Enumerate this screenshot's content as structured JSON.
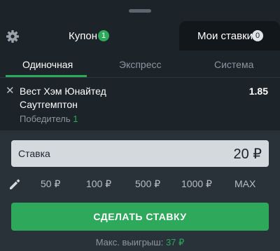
{
  "tabs": {
    "coupon_label": "Купон",
    "coupon_count": "1",
    "my_bets_label": "Мои ставки",
    "my_bets_count": "0"
  },
  "bet_types": [
    "Одиночная",
    "Экспресс",
    "Система"
  ],
  "active_bet_type": "Одиночная",
  "bet": {
    "team_home": "Вест Хэм Юнайтед",
    "team_away": "Саутгемптон",
    "outcome_label": "Победитель",
    "outcome_value": "1",
    "odd": "1.85"
  },
  "stake": {
    "label": "Ставка",
    "value": "20 ₽"
  },
  "quick_amounts": [
    "50 ₽",
    "100 ₽",
    "500 ₽",
    "1000 ₽",
    "MAX"
  ],
  "cta": "СДЕЛАТЬ СТАВКУ",
  "max_win": {
    "label": "Макс. выигрыш:",
    "value": "37 ₽"
  },
  "colors": {
    "accent_green": "#2ea85b",
    "background": "#1c2329",
    "panel": "#293139"
  }
}
